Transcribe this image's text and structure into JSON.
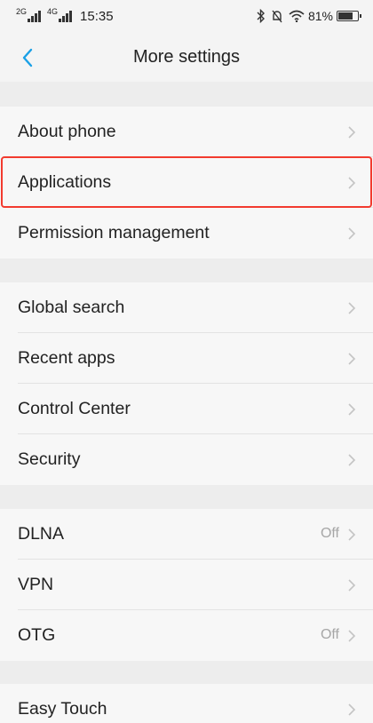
{
  "status_bar": {
    "sim1_type": "2G",
    "sim2_type": "4G",
    "time": "15:35",
    "battery": "81%",
    "battery_level": 0.81
  },
  "header": {
    "title": "More settings"
  },
  "rows": [
    {
      "label": "About phone",
      "value": ""
    },
    {
      "label": "Applications",
      "value": ""
    },
    {
      "label": "Permission management",
      "value": ""
    },
    {
      "label": "Global search",
      "value": ""
    },
    {
      "label": "Recent apps",
      "value": ""
    },
    {
      "label": "Control Center",
      "value": ""
    },
    {
      "label": "Security",
      "value": ""
    },
    {
      "label": "DLNA",
      "value": "Off"
    },
    {
      "label": "VPN",
      "value": ""
    },
    {
      "label": "OTG",
      "value": "Off"
    },
    {
      "label": "Easy Touch",
      "value": ""
    }
  ],
  "colors": {
    "accent": "#1aa0e6",
    "highlight": "#f23b2f"
  }
}
